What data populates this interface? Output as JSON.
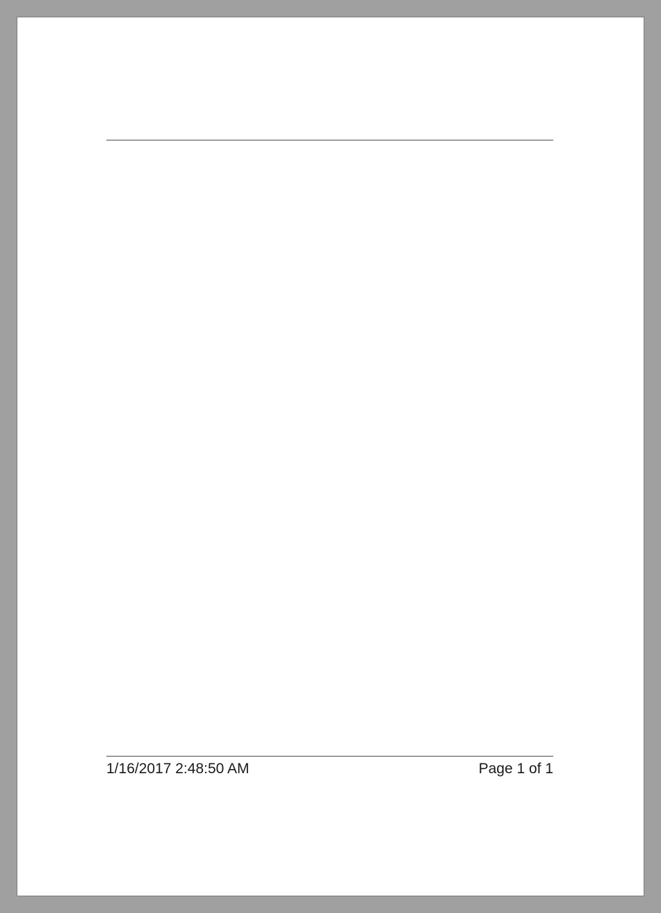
{
  "footer": {
    "timestamp": "1/16/2017 2:48:50 AM",
    "page_label": "Page 1 of 1"
  }
}
